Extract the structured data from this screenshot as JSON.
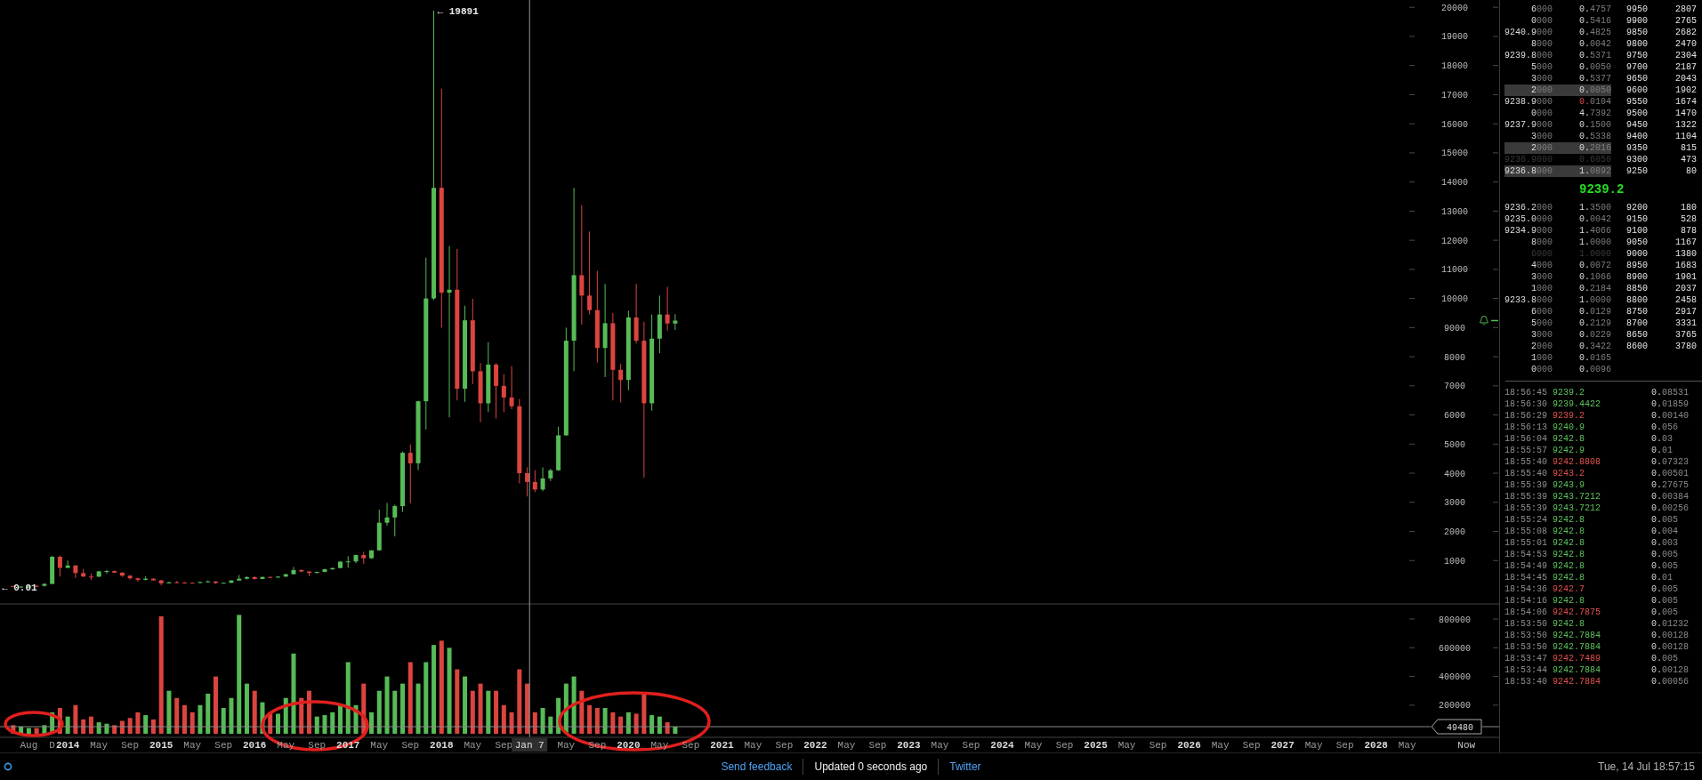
{
  "price_chart": {
    "axis_labels": [
      "20000",
      "19000",
      "18000",
      "17000",
      "16000",
      "15000",
      "14000",
      "13000",
      "12000",
      "11000",
      "10000",
      "9000",
      "8000",
      "7000",
      "6000",
      "5000",
      "4000",
      "3000",
      "2000",
      "1000"
    ],
    "high_label": "← 19891",
    "low_label": "← 0.01"
  },
  "volume_chart": {
    "axis_labels": [
      "800000",
      "600000",
      "400000",
      "200000"
    ],
    "last_value": "49480"
  },
  "time_axis": [
    {
      "label": "Aug",
      "kind": "month"
    },
    {
      "label": "D",
      "kind": "month"
    },
    {
      "label": "2014",
      "kind": "year"
    },
    {
      "label": "May",
      "kind": "month"
    },
    {
      "label": "Sep",
      "kind": "month"
    },
    {
      "label": "2015",
      "kind": "year"
    },
    {
      "label": "May",
      "kind": "month"
    },
    {
      "label": "Sep",
      "kind": "month"
    },
    {
      "label": "2016",
      "kind": "year"
    },
    {
      "label": "May",
      "kind": "month"
    },
    {
      "label": "Sep",
      "kind": "month"
    },
    {
      "label": "2017",
      "kind": "year"
    },
    {
      "label": "May",
      "kind": "month"
    },
    {
      "label": "Sep",
      "kind": "month"
    },
    {
      "label": "2018",
      "kind": "year"
    },
    {
      "label": "May",
      "kind": "month"
    },
    {
      "label": "Sep",
      "kind": "month"
    },
    {
      "label": "Jan 7",
      "kind": "crosshair"
    },
    {
      "label": "May",
      "kind": "month"
    },
    {
      "label": "Sep",
      "kind": "month"
    },
    {
      "label": "2020",
      "kind": "year"
    },
    {
      "label": "May",
      "kind": "month"
    },
    {
      "label": "Sep",
      "kind": "month"
    },
    {
      "label": "2021",
      "kind": "year"
    },
    {
      "label": "May",
      "kind": "month"
    },
    {
      "label": "Sep",
      "kind": "month"
    },
    {
      "label": "2022",
      "kind": "year"
    },
    {
      "label": "May",
      "kind": "month"
    },
    {
      "label": "Sep",
      "kind": "month"
    },
    {
      "label": "2023",
      "kind": "year"
    },
    {
      "label": "May",
      "kind": "month"
    },
    {
      "label": "Sep",
      "kind": "month"
    },
    {
      "label": "2024",
      "kind": "year"
    },
    {
      "label": "May",
      "kind": "month"
    },
    {
      "label": "Sep",
      "kind": "month"
    },
    {
      "label": "2025",
      "kind": "year"
    },
    {
      "label": "May",
      "kind": "month"
    },
    {
      "label": "Sep",
      "kind": "month"
    },
    {
      "label": "2026",
      "kind": "year"
    },
    {
      "label": "May",
      "kind": "month"
    },
    {
      "label": "Sep",
      "kind": "month"
    },
    {
      "label": "2027",
      "kind": "year"
    },
    {
      "label": "May",
      "kind": "month"
    },
    {
      "label": "Sep",
      "kind": "month"
    },
    {
      "label": "2028",
      "kind": "year"
    },
    {
      "label": "May",
      "kind": "month"
    },
    {
      "label": "Now",
      "kind": "now"
    }
  ],
  "order_book": {
    "asks": [
      {
        "price": "6000",
        "amount": "0.4757",
        "level": "9950",
        "total": "2807",
        "highlighted": false,
        "faded": false,
        "changed": false
      },
      {
        "price": "0000",
        "amount": "0.5416",
        "level": "9900",
        "total": "2765",
        "highlighted": false,
        "faded": false,
        "changed": false
      },
      {
        "price": "9240.9000",
        "amount": "0.4825",
        "level": "9850",
        "total": "2682",
        "highlighted": false,
        "faded": false,
        "changed": false
      },
      {
        "price": "8000",
        "amount": "0.0042",
        "level": "9800",
        "total": "2470",
        "highlighted": false,
        "faded": false,
        "changed": false
      },
      {
        "price": "9239.8000",
        "amount": "0.5371",
        "level": "9750",
        "total": "2304",
        "highlighted": false,
        "faded": false,
        "changed": false
      },
      {
        "price": "5000",
        "amount": "0.0050",
        "level": "9700",
        "total": "2187",
        "highlighted": false,
        "faded": false,
        "changed": false
      },
      {
        "price": "3000",
        "amount": "0.5377",
        "level": "9650",
        "total": "2043",
        "highlighted": false,
        "faded": false,
        "changed": false
      },
      {
        "price": "2000",
        "amount": "0.0050",
        "level": "9600",
        "total": "1902",
        "highlighted": true,
        "faded": false,
        "changed": false
      },
      {
        "price": "9238.9000",
        "amount": "0.0104",
        "level": "9550",
        "total": "1674",
        "highlighted": false,
        "faded": false,
        "changed": true
      },
      {
        "price": "0000",
        "amount": "4.7392",
        "level": "9500",
        "total": "1470",
        "highlighted": false,
        "faded": false,
        "changed": false
      },
      {
        "price": "9237.9000",
        "amount": "0.1500",
        "level": "9450",
        "total": "1322",
        "highlighted": false,
        "faded": false,
        "changed": false
      },
      {
        "price": "3000",
        "amount": "0.5338",
        "level": "9400",
        "total": "1104",
        "highlighted": false,
        "faded": false,
        "changed": false
      },
      {
        "price": "2000",
        "amount": "0.2016",
        "level": "9350",
        "total": "815",
        "highlighted": true,
        "faded": false,
        "changed": false
      },
      {
        "price": "9236.9000",
        "amount": "0.6050",
        "level": "9300",
        "total": "473",
        "highlighted": false,
        "faded": true,
        "changed": false
      },
      {
        "price": "9236.8000",
        "amount": "1.0892",
        "level": "9250",
        "total": "80",
        "highlighted": true,
        "faded": false,
        "changed": false
      }
    ],
    "last_price": "9239.2",
    "bids": [
      {
        "price": "9236.2000",
        "amount": "1.3500",
        "level": "9200",
        "total": "180",
        "highlighted": false,
        "faded": false,
        "changed": false
      },
      {
        "price": "9235.0000",
        "amount": "0.0042",
        "level": "9150",
        "total": "528",
        "highlighted": false,
        "faded": false,
        "changed": false
      },
      {
        "price": "9234.9000",
        "amount": "1.4066",
        "level": "9100",
        "total": "878",
        "highlighted": false,
        "faded": false,
        "changed": false
      },
      {
        "price": "8000",
        "amount": "1.0000",
        "level": "9050",
        "total": "1167",
        "highlighted": false,
        "faded": false,
        "changed": false
      },
      {
        "price": "6000",
        "amount": "1.0000",
        "level": "9000",
        "total": "1380",
        "highlighted": false,
        "faded": true,
        "changed": false
      },
      {
        "price": "4000",
        "amount": "0.0072",
        "level": "8950",
        "total": "1683",
        "highlighted": false,
        "faded": false,
        "changed": false
      },
      {
        "price": "3000",
        "amount": "0.1066",
        "level": "8900",
        "total": "1901",
        "highlighted": false,
        "faded": false,
        "changed": false
      },
      {
        "price": "1000",
        "amount": "0.2184",
        "level": "8850",
        "total": "2037",
        "highlighted": false,
        "faded": false,
        "changed": false
      },
      {
        "price": "9233.8000",
        "amount": "1.0000",
        "level": "8800",
        "total": "2458",
        "highlighted": false,
        "faded": false,
        "changed": false
      },
      {
        "price": "6000",
        "amount": "0.0129",
        "level": "8750",
        "total": "2917",
        "highlighted": false,
        "faded": false,
        "changed": false
      },
      {
        "price": "5000",
        "amount": "0.2129",
        "level": "8700",
        "total": "3331",
        "highlighted": false,
        "faded": false,
        "changed": false
      },
      {
        "price": "3000",
        "amount": "0.0229",
        "level": "8650",
        "total": "3765",
        "highlighted": false,
        "faded": false,
        "changed": false
      },
      {
        "price": "2000",
        "amount": "0.3422",
        "level": "8600",
        "total": "3780",
        "highlighted": false,
        "faded": false,
        "changed": false
      },
      {
        "price": "1000",
        "amount": "0.0165",
        "highlighted": false,
        "faded": false,
        "changed": false
      },
      {
        "price": "0000",
        "amount": "0.0096",
        "highlighted": false,
        "faded": false,
        "changed": false
      }
    ]
  },
  "trades": [
    {
      "time": "18:56:45",
      "price": "9239.2",
      "color": "#5ec15e",
      "amount": "0.08531"
    },
    {
      "time": "18:56:30",
      "price": "9239.4422",
      "color": "#5ec15e",
      "amount": "0.01859"
    },
    {
      "time": "18:56:29",
      "price": "9239.2",
      "color": "#e0524e",
      "amount": "0.00140"
    },
    {
      "time": "18:56:13",
      "price": "9240.9",
      "color": "#5ec15e",
      "amount": "0.056"
    },
    {
      "time": "18:56:04",
      "price": "9242.8",
      "color": "#5ec15e",
      "amount": "0.03"
    },
    {
      "time": "18:55:57",
      "price": "9242.9",
      "color": "#5ec15e",
      "amount": "0.01"
    },
    {
      "time": "18:55:40",
      "price": "9242.8808",
      "color": "#e0524e",
      "amount": "0.07323"
    },
    {
      "time": "18:55:40",
      "price": "9243.2",
      "color": "#e0524e",
      "amount": "0.00501"
    },
    {
      "time": "18:55:39",
      "price": "9243.9",
      "color": "#5ec15e",
      "amount": "0.27675"
    },
    {
      "time": "18:55:39",
      "price": "9243.7212",
      "color": "#5ec15e",
      "amount": "0.00384"
    },
    {
      "time": "18:55:39",
      "price": "9243.7212",
      "color": "#5ec15e",
      "amount": "0.00256"
    },
    {
      "time": "18:55:24",
      "price": "9242.8",
      "color": "#5ec15e",
      "amount": "0.005"
    },
    {
      "time": "18:55:08",
      "price": "9242.8",
      "color": "#5ec15e",
      "amount": "0.004"
    },
    {
      "time": "18:55:01",
      "price": "9242.8",
      "color": "#5ec15e",
      "amount": "0.003"
    },
    {
      "time": "18:54:53",
      "price": "9242.8",
      "color": "#5ec15e",
      "amount": "0.005"
    },
    {
      "time": "18:54:49",
      "price": "9242.8",
      "color": "#5ec15e",
      "amount": "0.005"
    },
    {
      "time": "18:54:45",
      "price": "9242.8",
      "color": "#5ec15e",
      "amount": "0.01"
    },
    {
      "time": "18:54:36",
      "price": "9242.7",
      "color": "#e0524e",
      "amount": "0.005"
    },
    {
      "time": "18:54:16",
      "price": "9242.8",
      "color": "#5ec15e",
      "amount": "0.005"
    },
    {
      "time": "18:54:06",
      "price": "9242.7875",
      "color": "#e0524e",
      "amount": "0.005"
    },
    {
      "time": "18:53:50",
      "price": "9242.8",
      "color": "#5ec15e",
      "amount": "0.01232"
    },
    {
      "time": "18:53:50",
      "price": "9242.7884",
      "color": "#5ec15e",
      "amount": "0.00128"
    },
    {
      "time": "18:53:50",
      "price": "9242.7884",
      "color": "#5ec15e",
      "amount": "0.00128"
    },
    {
      "time": "18:53:47",
      "price": "9242.7489",
      "color": "#e0524e",
      "amount": "0.005"
    },
    {
      "time": "18:53:44",
      "price": "9242.7884",
      "color": "#5ec15e",
      "amount": "0.00128"
    },
    {
      "time": "18:53:40",
      "price": "9242.7884",
      "color": "#e0524e",
      "amount": "0.00056"
    }
  ],
  "status_bar": {
    "items": [
      {
        "kind": "link",
        "text": "Send feedback"
      },
      {
        "kind": "text",
        "text": "Updated 0 seconds ago"
      },
      {
        "kind": "link",
        "text": "Twitter"
      }
    ],
    "clock": "Tue, 14 Jul 18:57:15"
  }
}
